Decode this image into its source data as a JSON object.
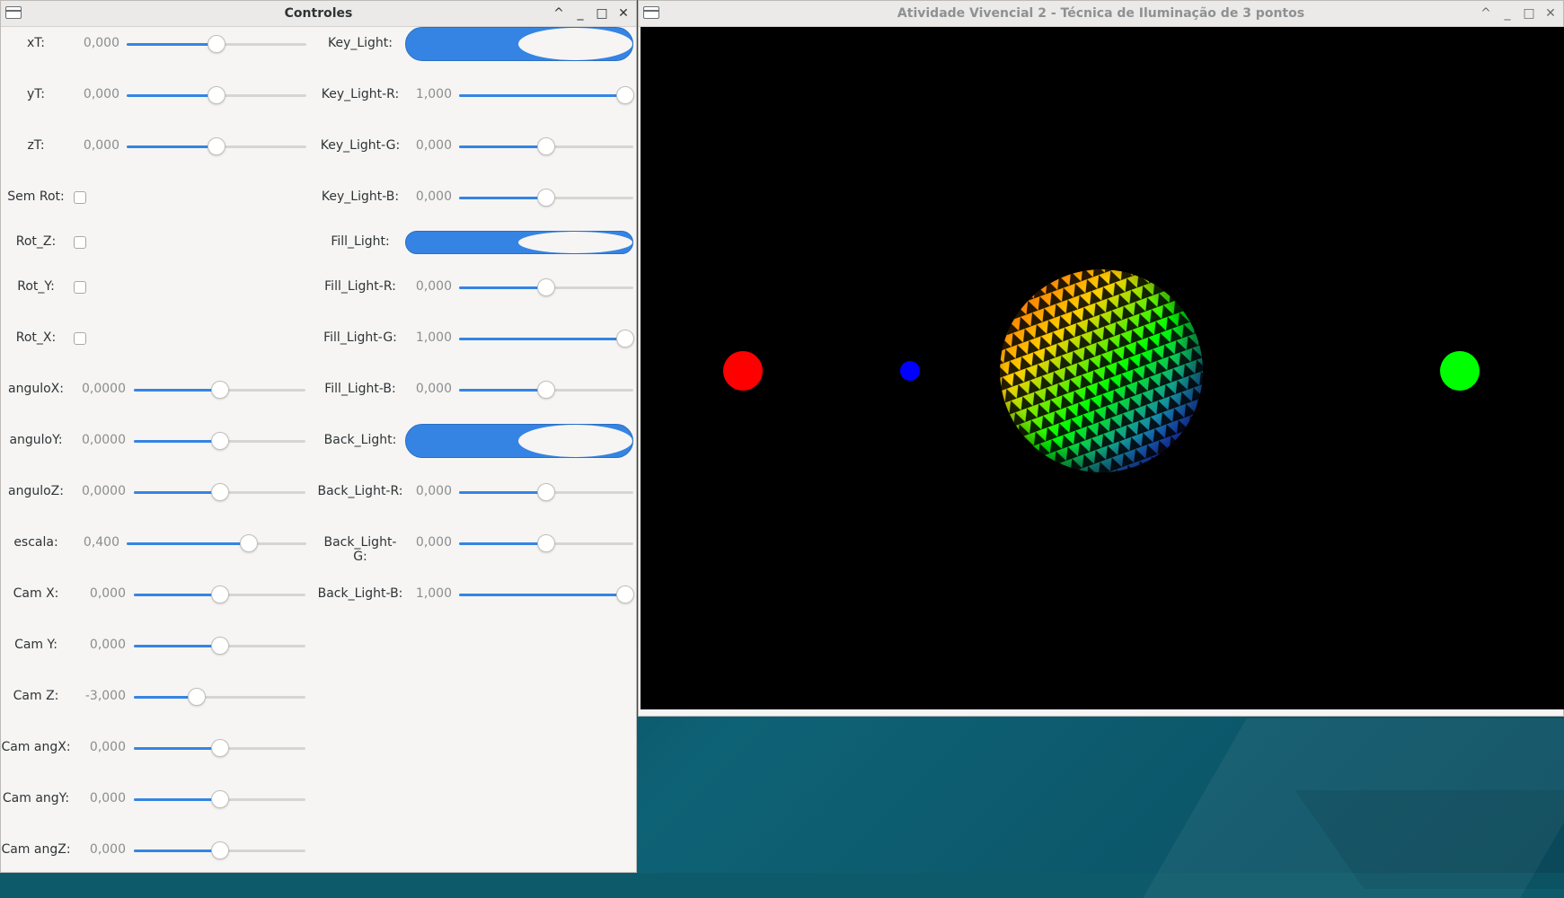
{
  "controls_window": {
    "title": "Controles",
    "buttons": {
      "menu": "window-menu",
      "up": "^",
      "minimize": "_",
      "maximize": "□",
      "close": "✕"
    },
    "left_rows": [
      {
        "type": "slider",
        "label": "xT:",
        "value": "0,000",
        "fraction": 0.5
      },
      {
        "type": "slider",
        "label": "yT:",
        "value": "0,000",
        "fraction": 0.5
      },
      {
        "type": "slider",
        "label": "zT:",
        "value": "0,000",
        "fraction": 0.5
      },
      {
        "type": "checkbox",
        "label": "Sem Rot:",
        "checked": false
      },
      {
        "type": "checkbox",
        "label": "Rot_Z:",
        "checked": false
      },
      {
        "type": "checkbox",
        "label": "Rot_Y:",
        "checked": false
      },
      {
        "type": "checkbox",
        "label": "Rot_X:",
        "checked": false
      },
      {
        "type": "slider",
        "label": "anguloX:",
        "value": "0,0000",
        "fraction": 0.5
      },
      {
        "type": "slider",
        "label": "anguloY:",
        "value": "0,0000",
        "fraction": 0.5
      },
      {
        "type": "slider",
        "label": "anguloZ:",
        "value": "0,0000",
        "fraction": 0.5
      },
      {
        "type": "slider",
        "label": "escala:",
        "value": "0,400",
        "fraction": 0.7
      },
      {
        "type": "slider",
        "label": "Cam X:",
        "value": "0,000",
        "fraction": 0.5
      },
      {
        "type": "slider",
        "label": "Cam Y:",
        "value": "0,000",
        "fraction": 0.5
      },
      {
        "type": "slider",
        "label": "Cam Z:",
        "value": "-3,000",
        "fraction": 0.35
      },
      {
        "type": "slider",
        "label": "Cam angX:",
        "value": "0,000",
        "fraction": 0.5
      },
      {
        "type": "slider",
        "label": "Cam angY:",
        "value": "0,000",
        "fraction": 0.5
      },
      {
        "type": "slider",
        "label": "Cam angZ:",
        "value": "0,000",
        "fraction": 0.5
      }
    ],
    "right_rows": [
      {
        "type": "switch",
        "label": "Key_Light:",
        "on": true
      },
      {
        "type": "slider",
        "label": "Key_Light-R:",
        "value": "1,000",
        "fraction": 1.0
      },
      {
        "type": "slider",
        "label": "Key_Light-G:",
        "value": "0,000",
        "fraction": 0.5
      },
      {
        "type": "slider",
        "label": "Key_Light-B:",
        "value": "0,000",
        "fraction": 0.5
      },
      {
        "type": "switch",
        "label": "Fill_Light:",
        "on": true
      },
      {
        "type": "slider",
        "label": "Fill_Light-R:",
        "value": "0,000",
        "fraction": 0.5
      },
      {
        "type": "slider",
        "label": "Fill_Light-G:",
        "value": "1,000",
        "fraction": 1.0
      },
      {
        "type": "slider",
        "label": "Fill_Light-B:",
        "value": "0,000",
        "fraction": 0.5
      },
      {
        "type": "switch",
        "label": "Back_Light:",
        "on": true
      },
      {
        "type": "slider",
        "label": "Back_Light-R:",
        "value": "0,000",
        "fraction": 0.5
      },
      {
        "type": "slider",
        "label": "Back_Light-G:",
        "value": "0,000",
        "fraction": 0.5
      },
      {
        "type": "slider",
        "label": "Back_Light-B:",
        "value": "1,000",
        "fraction": 1.0
      }
    ]
  },
  "render_window": {
    "title": "Atividade Vivencial 2 - Técnica de Iluminação de 3 pontos",
    "buttons": {
      "up": "^",
      "minimize": "_",
      "maximize": "□",
      "close": "✕"
    },
    "scene": {
      "background": "#000000",
      "key_light_marker": {
        "color": "#ff0000"
      },
      "back_light_marker": {
        "color": "#0000ff"
      },
      "fill_light_marker": {
        "color": "#00ff00"
      },
      "sphere": {
        "colors": [
          "#ff3b00",
          "#ffd000",
          "#00ff00",
          "#2050ff",
          "#7a00c0"
        ]
      }
    }
  },
  "colors": {
    "accent": "#3584e4",
    "window_bg": "#f6f5f4",
    "desktop": "#0d5a6b"
  }
}
